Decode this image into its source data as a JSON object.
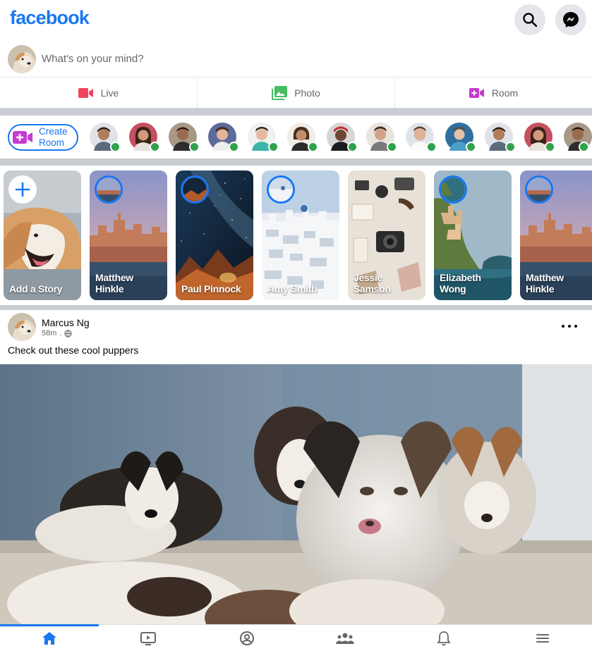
{
  "header": {
    "logo": "facebook",
    "search_icon": "search-icon",
    "messenger_icon": "messenger-icon"
  },
  "composer": {
    "placeholder": "What's on your mind?",
    "actions": [
      {
        "label": "Live",
        "icon": "video-camera-icon",
        "color": "#f3425f"
      },
      {
        "label": "Photo",
        "icon": "photo-icon",
        "color": "#45bd62"
      },
      {
        "label": "Room",
        "icon": "video-plus-icon",
        "color": "#c53bd3"
      }
    ]
  },
  "rooms": {
    "create_label": "Create Room",
    "online_count": 13,
    "status_color": "#31a24c"
  },
  "stories": [
    {
      "name": "Add a Story",
      "type": "add"
    },
    {
      "name": "Matthew Hinkle"
    },
    {
      "name": "Paul Pinnock"
    },
    {
      "name": "Amy Smith"
    },
    {
      "name": "Jessie Samson"
    },
    {
      "name": "Elizabeth Wong"
    },
    {
      "name": "Matthew Hinkle"
    }
  ],
  "post": {
    "author": "Marcus Ng",
    "time": "58m",
    "separator": ".",
    "privacy_icon": "globe-icon",
    "text": "Check out these cool puppers"
  },
  "bottom_nav": [
    {
      "icon": "home-icon",
      "active": true
    },
    {
      "icon": "watch-icon",
      "active": false
    },
    {
      "icon": "profile-icon",
      "active": false
    },
    {
      "icon": "groups-icon",
      "active": false
    },
    {
      "icon": "bell-icon",
      "active": false
    },
    {
      "icon": "menu-icon",
      "active": false
    }
  ],
  "colors": {
    "brand": "#1877f2",
    "bg": "#c9ccd1",
    "text": "#050505",
    "muted": "#65676b"
  }
}
